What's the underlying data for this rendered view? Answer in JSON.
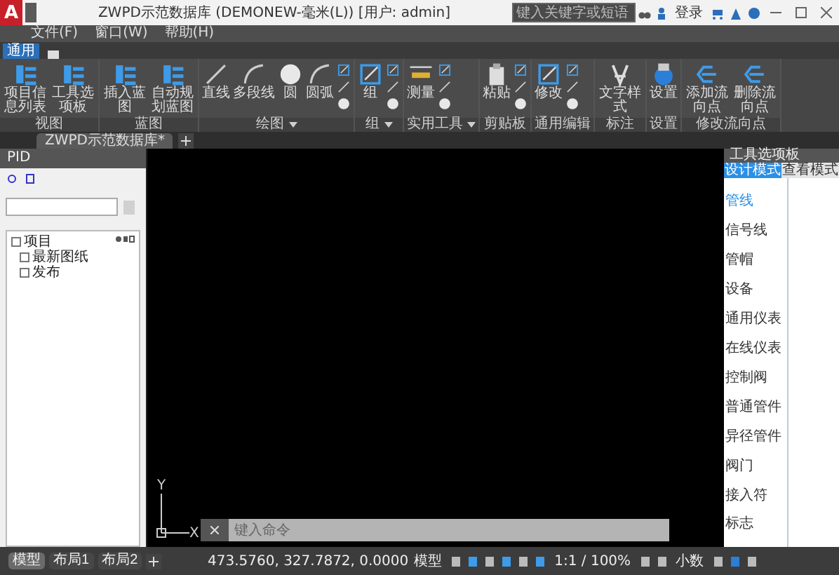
{
  "app_logo": {
    "letter": "A"
  },
  "window": {
    "title": "ZWPD示范数据库 (DEMONEW-毫米(L)) [用户: admin]"
  },
  "search": {
    "placeholder": "键入关键字或短语"
  },
  "login": {
    "label": "登录"
  },
  "menu": [
    "文件(F)",
    "窗口(W)",
    "帮助(H)"
  ],
  "ribbon_tabs": [
    {
      "label": "通用",
      "selected": true
    }
  ],
  "ribbon_groups": [
    {
      "label": "视图",
      "dropdown": false,
      "tools": [
        {
          "kind": "large",
          "label": "项目信息列表"
        },
        {
          "kind": "large",
          "label": "工具选项板"
        }
      ]
    },
    {
      "label": "蓝图",
      "dropdown": false,
      "tools": [
        {
          "kind": "large",
          "label": "插入蓝图"
        },
        {
          "kind": "large",
          "label": "自动规划蓝图"
        }
      ]
    },
    {
      "label": "绘图",
      "dropdown": true,
      "tools": [
        {
          "kind": "large",
          "label": "直线"
        },
        {
          "kind": "large",
          "label": "多段线"
        },
        {
          "kind": "large",
          "label": "圆"
        },
        {
          "kind": "large",
          "label": "圆弧"
        },
        {
          "kind": "stack"
        }
      ]
    },
    {
      "label": "组",
      "dropdown": true,
      "tools": [
        {
          "kind": "large",
          "label": "组"
        },
        {
          "kind": "stack"
        }
      ]
    },
    {
      "label": "实用工具",
      "dropdown": true,
      "tools": [
        {
          "kind": "large",
          "label": "测量"
        },
        {
          "kind": "stack"
        }
      ]
    },
    {
      "label": "剪贴板",
      "dropdown": false,
      "tools": [
        {
          "kind": "large",
          "label": "粘贴"
        },
        {
          "kind": "stack"
        }
      ]
    },
    {
      "label": "通用编辑",
      "dropdown": false,
      "tools": [
        {
          "kind": "large",
          "label": "修改"
        },
        {
          "kind": "stack"
        }
      ]
    },
    {
      "label": "标注",
      "dropdown": false,
      "tools": [
        {
          "kind": "large",
          "label": "文字样式"
        }
      ]
    },
    {
      "label": "设置",
      "dropdown": false,
      "tools": [
        {
          "kind": "large",
          "label": "设置"
        }
      ]
    },
    {
      "label": "修改流向点",
      "dropdown": false,
      "tools": [
        {
          "kind": "large",
          "label": "添加流向点"
        },
        {
          "kind": "large",
          "label": "删除流向点"
        }
      ]
    }
  ],
  "document_tabs": [
    {
      "label": "ZWPD示范数据库*",
      "selected": true
    }
  ],
  "left_panel": {
    "title": "PID",
    "tree": [
      {
        "label": "项目",
        "children": [
          {
            "label": "最新图纸"
          },
          {
            "label": "发布"
          }
        ]
      }
    ]
  },
  "right_panel": {
    "title": "工具选项板",
    "tabs": [
      {
        "label": "设计模式",
        "selected": true
      },
      {
        "label": "查看模式",
        "selected": false
      }
    ],
    "categories": [
      {
        "label": "管线",
        "selected": true
      },
      {
        "label": "信号线",
        "selected": false
      },
      {
        "label": "管帽",
        "selected": false
      },
      {
        "label": "设备",
        "selected": false
      },
      {
        "label": "通用仪表",
        "selected": false
      },
      {
        "label": "在线仪表",
        "selected": false
      },
      {
        "label": "控制阀",
        "selected": false
      },
      {
        "label": "普通管件",
        "selected": false
      },
      {
        "label": "异径管件",
        "selected": false
      },
      {
        "label": "阀门",
        "selected": false
      },
      {
        "label": "接入符",
        "selected": false
      },
      {
        "label": "标志",
        "selected": false
      }
    ]
  },
  "canvas": {
    "y_axis": "Y",
    "x_axis": "X"
  },
  "command_line": {
    "placeholder": "键入命令"
  },
  "layout_tabs": [
    {
      "label": "模型",
      "selected": true
    },
    {
      "label": "布局1",
      "selected": false
    },
    {
      "label": "布局2",
      "selected": false
    }
  ],
  "status_bar": {
    "coordinates": "473.5760, 327.7872, 0.0000",
    "space": "模型",
    "scale": "1:1 / 100%",
    "units": "小数"
  }
}
